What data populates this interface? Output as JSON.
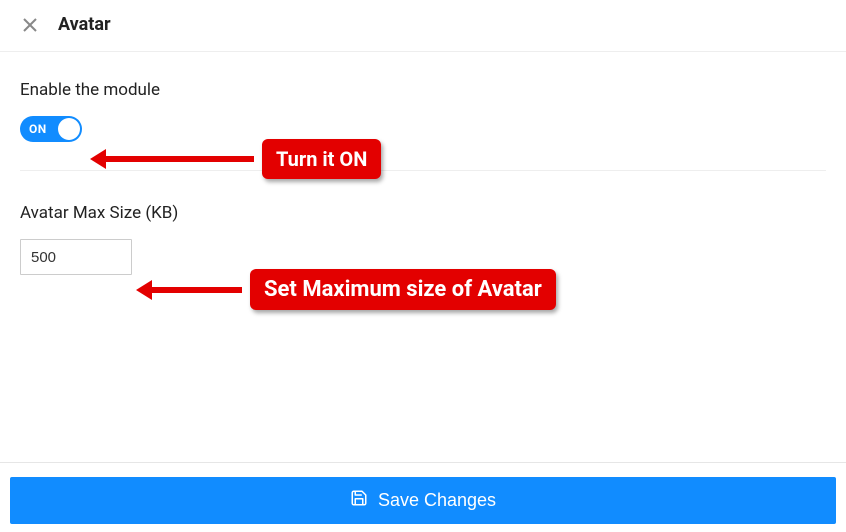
{
  "header": {
    "title": "Avatar"
  },
  "sections": {
    "enable": {
      "label": "Enable the module",
      "toggle_state": "ON"
    },
    "max_size": {
      "label": "Avatar Max Size (KB)",
      "value": "500"
    }
  },
  "annotations": {
    "turn_on": "Turn it ON",
    "set_max": "Set Maximum size of Avatar"
  },
  "footer": {
    "save_label": "Save Changes"
  }
}
